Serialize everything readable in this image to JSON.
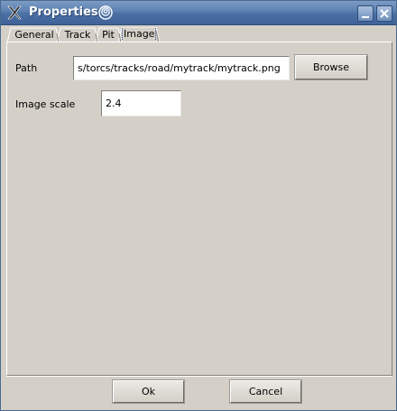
{
  "window": {
    "title": "Properties",
    "app_icon": "x-logo-icon",
    "title_decoration_icon": "spiral-icon",
    "controls": {
      "minimize_icon": "minimize-icon",
      "close_icon": "close-icon"
    }
  },
  "tabs": [
    {
      "label": "General",
      "active": false
    },
    {
      "label": "Track",
      "active": false
    },
    {
      "label": "Pit",
      "active": false
    },
    {
      "label": "Image",
      "active": true
    }
  ],
  "image_tab": {
    "path_label": "Path",
    "path_value": "s/torcs/tracks/road/mytrack/mytrack.png",
    "browse_label": "Browse",
    "scale_label": "Image scale",
    "scale_value": "2.4"
  },
  "footer": {
    "ok_label": "Ok",
    "cancel_label": "Cancel"
  },
  "colors": {
    "titlebar": "#5a7fb0",
    "window_bg": "#d4d0c8",
    "field_bg": "#ffffff"
  }
}
